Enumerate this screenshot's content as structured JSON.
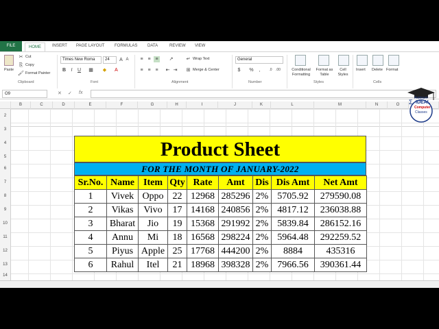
{
  "tabs": {
    "file": "FILE",
    "items": [
      "HOME",
      "INSERT",
      "PAGE LAYOUT",
      "FORMULAS",
      "DATA",
      "REVIEW",
      "VIEW"
    ]
  },
  "clipboard": {
    "paste": "Paste",
    "cut": "Cut",
    "copy": "Copy",
    "format_painter": "Format Painter",
    "label": "Clipboard"
  },
  "font": {
    "name": "Times New Roma",
    "size": "24",
    "label": "Font",
    "bold": "B",
    "italic": "I",
    "underline": "U"
  },
  "alignment": {
    "wrap_text": "Wrap Text",
    "merge_center": "Merge & Center",
    "label": "Alignment"
  },
  "number": {
    "format": "General",
    "currency": "$",
    "percent": "%",
    "comma": ",",
    "label": "Number"
  },
  "styles": {
    "conditional": "Conditional Formatting",
    "format_table": "Format as Table",
    "cell_styles": "Cell Styles",
    "label": "Styles"
  },
  "cells": {
    "insert": "Insert",
    "delete": "Delete",
    "format": "Format",
    "label": "Cells"
  },
  "formula_bar": {
    "name_box": "O9",
    "fx": "fx"
  },
  "columns": [
    "B",
    "C",
    "D",
    "E",
    "F",
    "G",
    "H",
    "I",
    "J",
    "K",
    "L",
    "M",
    "N",
    "O",
    "P"
  ],
  "rows": [
    "2",
    "3",
    "4",
    "5",
    "6",
    "7",
    "8",
    "9",
    "10",
    "11",
    "12",
    "13",
    "14"
  ],
  "sheet": {
    "title": "Product Sheet",
    "subtitle": "FOR THE MONTH OF JANUARY-2022",
    "headers": [
      "Sr.No.",
      "Name",
      "Item",
      "Qty",
      "Rate",
      "Amt",
      "Dis",
      "Dis Amt",
      "Net Amt"
    ],
    "rows": [
      [
        "1",
        "Vivek",
        "Oppo",
        "22",
        "12968",
        "285296",
        "2%",
        "5705.92",
        "279590.08"
      ],
      [
        "2",
        "Vikas",
        "Vivo",
        "17",
        "14168",
        "240856",
        "2%",
        "4817.12",
        "236038.88"
      ],
      [
        "3",
        "Bharat",
        "Jio",
        "19",
        "15368",
        "291992",
        "2%",
        "5839.84",
        "286152.16"
      ],
      [
        "4",
        "Annu",
        "Mi",
        "18",
        "16568",
        "298224",
        "2%",
        "5964.48",
        "292259.52"
      ],
      [
        "5",
        "Piyus",
        "Apple",
        "25",
        "17768",
        "444200",
        "2%",
        "8884",
        "435316"
      ],
      [
        "6",
        "Rahul",
        "Itel",
        "21",
        "18968",
        "398328",
        "2%",
        "7966.56",
        "390361.44"
      ]
    ]
  },
  "logo": {
    "text1": "Autosum",
    "text2": "IDEAL",
    "text3": "Computer",
    "text4": "Classes"
  },
  "colors": {
    "accent": "#217346",
    "title_bg": "#ffff00",
    "subtitle_bg": "#00b0f0"
  }
}
